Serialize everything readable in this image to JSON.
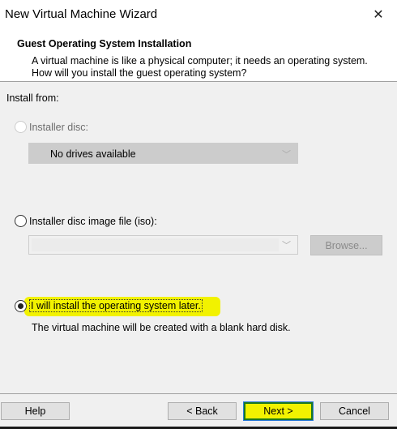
{
  "window": {
    "title": "New Virtual Machine Wizard"
  },
  "header": {
    "title": "Guest Operating System Installation",
    "description": "A virtual machine is like a physical computer; it needs an operating system. How will you install the guest operating system?"
  },
  "install_from_label": "Install from:",
  "options": [
    {
      "label": "Installer disc:",
      "selected": false,
      "enabled": false
    },
    {
      "label": "Installer disc image file (iso):",
      "selected": false,
      "enabled": true
    },
    {
      "label": "I will install the operating system later.",
      "selected": true,
      "enabled": true,
      "note": "The virtual machine will be created with a blank hard disk."
    }
  ],
  "disc_dropdown": {
    "value": "No drives available"
  },
  "iso_dropdown": {
    "value": ""
  },
  "browse_label": "Browse...",
  "buttons": {
    "help": "Help",
    "back": "< Back",
    "next": "Next >",
    "cancel": "Cancel"
  },
  "highlight_color": "#f2f200"
}
